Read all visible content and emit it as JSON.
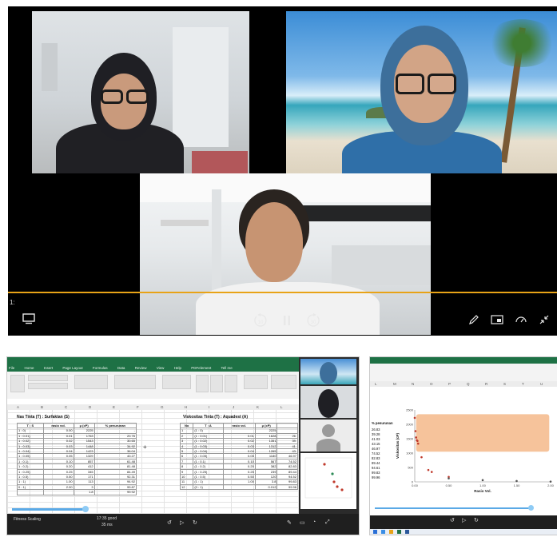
{
  "player": {
    "time_label": "1:",
    "controls": {
      "captions_icon": "captions-icon",
      "rewind_label": "10",
      "pause_icon": "pause-icon",
      "forward_label": "30",
      "pen_icon": "pen-icon",
      "pip_icon": "picture-in-picture-icon",
      "speed_icon": "speed-icon",
      "exit_fullscreen_icon": "exit-fullscreen-icon"
    },
    "accent": "#e8a317"
  },
  "excel": {
    "tabs": [
      "File",
      "Home",
      "Insert",
      "Page Layout",
      "Formulas",
      "Data",
      "Review",
      "View",
      "Help",
      "PDFelement",
      "Tell me"
    ],
    "columns": [
      "A",
      "B",
      "C",
      "D",
      "E",
      "F",
      "G",
      "H",
      "I",
      "J",
      "K",
      "L"
    ],
    "left_title": "Nas Tinta (T) : Surfaktan (S)",
    "right_title": "Viskositas Tinta (T) : Aquadest (A)",
    "left_table": {
      "headers": [
        "T : S",
        "rasio vol.",
        "μ (cP)",
        "% penurunan"
      ],
      "rows": [
        [
          "1 : 0)",
          "0.00",
          "2225",
          "-"
        ],
        [
          "1 : 0.01)",
          "0.01",
          "1763",
          "20.76"
        ],
        [
          "1 : 0.02)",
          "0.02",
          "1543",
          "30.65"
        ],
        [
          "1 : 0.03)",
          "0.03",
          "1448",
          "34.92"
        ],
        [
          "1 : 0.04)",
          "0.04",
          "1423",
          "36.04"
        ],
        [
          "1 : 0.05)",
          "0.05",
          "1329",
          "40.27"
        ],
        [
          "1 : 0.1)",
          "0.10",
          "857",
          "61.48"
        ],
        [
          "1 : 0.2)",
          "0.20",
          "412",
          "81.48"
        ],
        [
          "1 : 0.25)",
          "0.25",
          "345",
          "84.49"
        ],
        [
          "1 : 0.5)",
          "0.50",
          "171",
          "92.31"
        ],
        [
          "1 : 1)",
          "1.00",
          "113",
          "94.92"
        ],
        [
          "0 : 1)",
          "2.00",
          "3",
          "99.87"
        ],
        [
          "",
          "",
          "1.8",
          "99.92"
        ]
      ]
    },
    "right_table": {
      "headers": [
        "No",
        "T : A",
        "rasio vol.",
        "μ (cP)",
        ""
      ],
      "rows": [
        [
          "1",
          "(1 : 0)",
          "",
          "2225",
          ""
        ],
        [
          "2",
          "(1 : 0.01)",
          "0.01",
          "1628",
          "26."
        ],
        [
          "3",
          "(1 : 0.02)",
          "0.02",
          "1351",
          "39."
        ],
        [
          "4",
          "(1 : 0.03)",
          "0.03",
          "1312",
          "41."
        ],
        [
          "5",
          "(1 : 0.04)",
          "0.04",
          "1265",
          "43."
        ],
        [
          "6",
          "(1 : 0.05)",
          "0.05",
          "1180",
          "46.97"
        ],
        [
          "7",
          "(1 : 0.1)",
          "0.10",
          "567",
          "74.52"
        ],
        [
          "8",
          "(1 : 0.2)",
          "0.20",
          "382",
          "82.83"
        ],
        [
          "9",
          "(1 : 0.25)",
          "0.25",
          "239",
          "89.44"
        ],
        [
          "10",
          "(1 : 0.5)",
          "0.50",
          "120",
          "94.52"
        ],
        [
          "11",
          "(1 : 1)",
          "1.00",
          "3.8",
          "99.83"
        ],
        [
          "12",
          "(0 : 1)",
          "",
          "0.012",
          "99.96"
        ]
      ]
    },
    "footer_time": "17:35 good",
    "footer_sub": "35 ms",
    "footer_left": "Fitness Scaling"
  },
  "chart_panel": {
    "columns": [
      "L",
      "M",
      "N",
      "O",
      "P",
      "Q",
      "R",
      "S",
      "T",
      "U"
    ],
    "left_cut_label": "% penurunan",
    "left_cut_values": [
      "26.83",
      "39.28",
      "41.03",
      "43.15",
      "46.97",
      "74.52",
      "82.83",
      "89.44",
      "94.61",
      "99.83",
      "99.96"
    ]
  },
  "chart_data": {
    "type": "scatter",
    "xlabel": "Rasio Vol.",
    "ylabel": "Viskositas (cP)",
    "x_tick_labels": [
      "0.00",
      "0.50",
      "1.00",
      "1.50",
      "2.00"
    ],
    "y_tick_labels": [
      "0",
      "500",
      "1000",
      "1500",
      "2000",
      "2500"
    ],
    "xlim": [
      0,
      2.0
    ],
    "ylim": [
      0,
      2500
    ],
    "series": [
      {
        "color": "#c0392b",
        "x": [
          0.0,
          0.01,
          0.02,
          0.03,
          0.04,
          0.05,
          0.1,
          0.2,
          0.25,
          0.5
        ],
        "y": [
          2225,
          1763,
          1543,
          1448,
          1423,
          1329,
          857,
          412,
          345,
          171
        ]
      },
      {
        "color": "#555555",
        "x": [
          0.5,
          1.0,
          1.5,
          2.0
        ],
        "y": [
          120,
          60,
          30,
          10
        ]
      }
    ],
    "highlight_color": "#f5b98a"
  }
}
